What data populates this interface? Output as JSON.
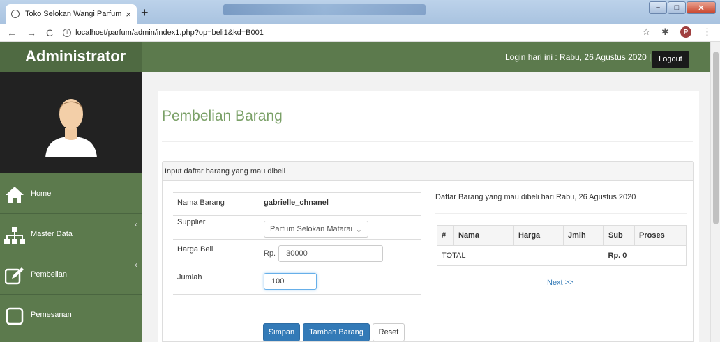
{
  "browser": {
    "tab_title": "Toko Selokan Wangi Parfum",
    "tab_close": "×",
    "new_tab": "+",
    "url": "localhost/parfum/admin/index1.php?op=beli1&kd=B001",
    "profile_letter": "P"
  },
  "sidebar": {
    "brand": "Administrator",
    "items": [
      {
        "label": "Home",
        "icon": "home-icon"
      },
      {
        "label": "Master Data",
        "icon": "sitemap-icon"
      },
      {
        "label": "Pembelian",
        "icon": "edit-icon"
      },
      {
        "label": "Pemesanan",
        "icon": "square-icon"
      }
    ]
  },
  "header": {
    "login_text": "Login hari ini : Rabu, 26 Agustus 2020 |",
    "logout_label": "Logout"
  },
  "main": {
    "page_title": "Pembelian Barang",
    "panel_title": "Input daftar barang yang mau dibeli",
    "form": {
      "nama_label": "Nama Barang",
      "nama_value": "gabrielle_chnanel",
      "supplier_label": "Supplier",
      "supplier_value": "Parfum Selokan Mataram",
      "harga_label": "Harga Beli",
      "harga_prefix": "Rp.",
      "harga_value": "30000",
      "jumlah_label": "Jumlah",
      "jumlah_value": "100"
    },
    "buttons": {
      "simpan": "Simpan",
      "tambah": "Tambah Barang",
      "reset": "Reset"
    },
    "list": {
      "title": "Daftar Barang yang mau dibeli hari Rabu, 26 Agustus 2020",
      "columns": [
        "#",
        "Nama",
        "Harga",
        "Jmlh",
        "Sub",
        "Proses"
      ],
      "total_label": "TOTAL",
      "total_value": "Rp. 0",
      "next_label": "Next >>"
    }
  }
}
